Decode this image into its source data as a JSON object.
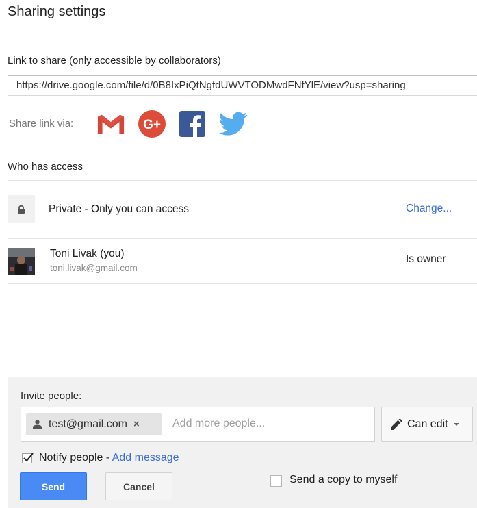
{
  "dialog": {
    "title": "Sharing settings"
  },
  "link": {
    "label": "Link to share (only accessible by collaborators)",
    "url": "https://drive.google.com/file/d/0B8IxPiQtNgfdUWVTODMwdFNfYlE/view?usp=sharing"
  },
  "share_via": {
    "label": "Share link via:",
    "services": [
      "gmail-icon",
      "google-plus-icon",
      "facebook-icon",
      "twitter-icon"
    ]
  },
  "access": {
    "heading": "Who has access",
    "visibility_text": "Private - Only you can access",
    "change_link": "Change...",
    "owner": {
      "name": "Toni Livak (you)",
      "email": "toni.livak@gmail.com",
      "role": "Is owner"
    }
  },
  "invite": {
    "label": "Invite people:",
    "chip_email": "test@gmail.com",
    "chip_remove": "×",
    "placeholder": "Add more people...",
    "permission": "Can edit",
    "notify_label": "Notify people",
    "notify_separator": " - ",
    "add_message": "Add message",
    "notify_checked": true,
    "send_copy_label": "Send a copy to myself",
    "send_copy_checked": false,
    "send_button": "Send",
    "cancel_button": "Cancel"
  },
  "colors": {
    "accent_link": "#3b6fd6",
    "primary_button": "#4a8af4",
    "panel_bg": "#f1f1f1"
  }
}
